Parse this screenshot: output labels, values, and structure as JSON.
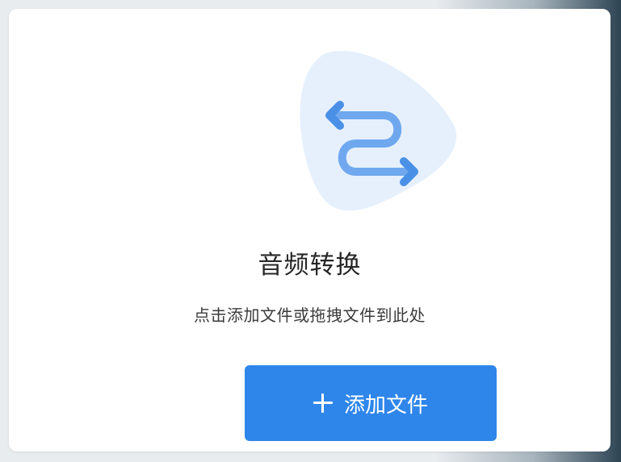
{
  "main": {
    "icon": "audio-convert-icon",
    "title": "音频转换",
    "hint": "点击添加文件或拖拽文件到此处",
    "add_button": {
      "icon": "plus-icon",
      "label": "添加文件"
    }
  },
  "colors": {
    "accent": "#2f86ea",
    "icon_blob": "#e6f0fd",
    "icon_stroke": "#4a90e6"
  }
}
